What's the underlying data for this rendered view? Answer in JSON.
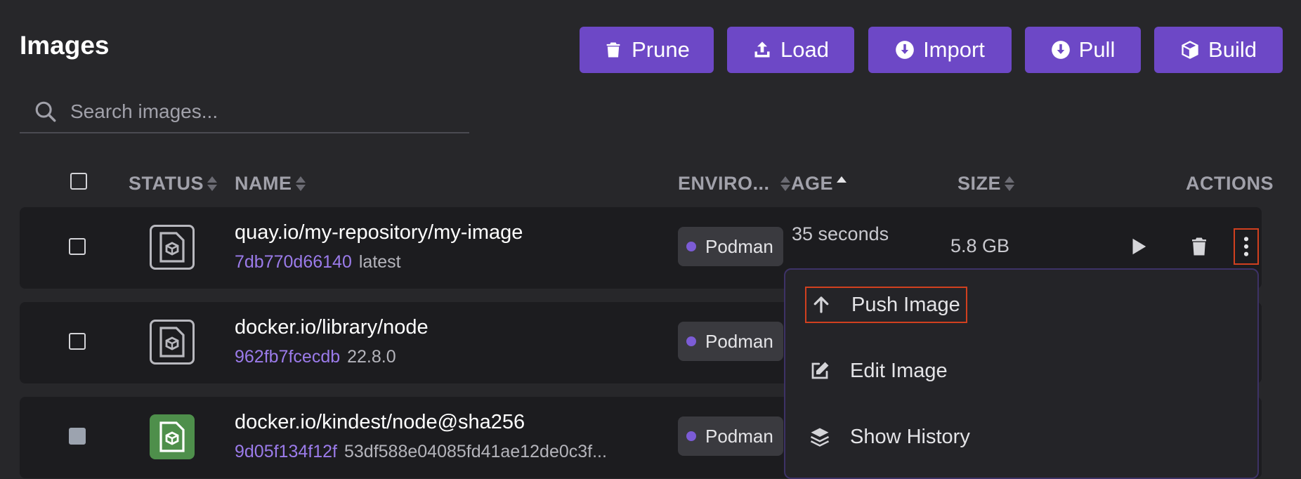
{
  "page": {
    "title": "Images"
  },
  "toolbar": {
    "prune": "Prune",
    "load": "Load",
    "import": "Import",
    "pull": "Pull",
    "build": "Build"
  },
  "search": {
    "placeholder": "Search images..."
  },
  "table": {
    "headers": {
      "status": "STATUS",
      "name": "NAME",
      "environment": "ENVIRO...",
      "age": "AGE",
      "size": "SIZE",
      "actions": "ACTIONS"
    },
    "rows": [
      {
        "name": "quay.io/my-repository/my-image",
        "id": "7db770d66140",
        "tag": "latest",
        "environment": "Podman",
        "age": "35 seconds",
        "size": "5.8 GB",
        "status": "unused"
      },
      {
        "name": "docker.io/library/node",
        "id": "962fb7fcecdb",
        "tag": "22.8.0",
        "environment": "Podman",
        "status": "unused"
      },
      {
        "name": "docker.io/kindest/node@sha256",
        "id": "9d05f134f12f",
        "tag": "53df588e04085fd41ae12de0c3f...",
        "environment": "Podman",
        "status": "in-use"
      }
    ]
  },
  "menu": {
    "items": [
      {
        "label": "Push Image",
        "icon": "arrow-up-icon"
      },
      {
        "label": "Edit Image",
        "icon": "edit-icon"
      },
      {
        "label": "Show History",
        "icon": "layers-icon"
      }
    ]
  },
  "colors": {
    "background": "#27272a",
    "row_background": "#1c1c1f",
    "accent": "#6d48c6",
    "link": "#9b7bea",
    "highlight_border": "#d1401f",
    "in_use_icon": "#4e8f4b"
  }
}
